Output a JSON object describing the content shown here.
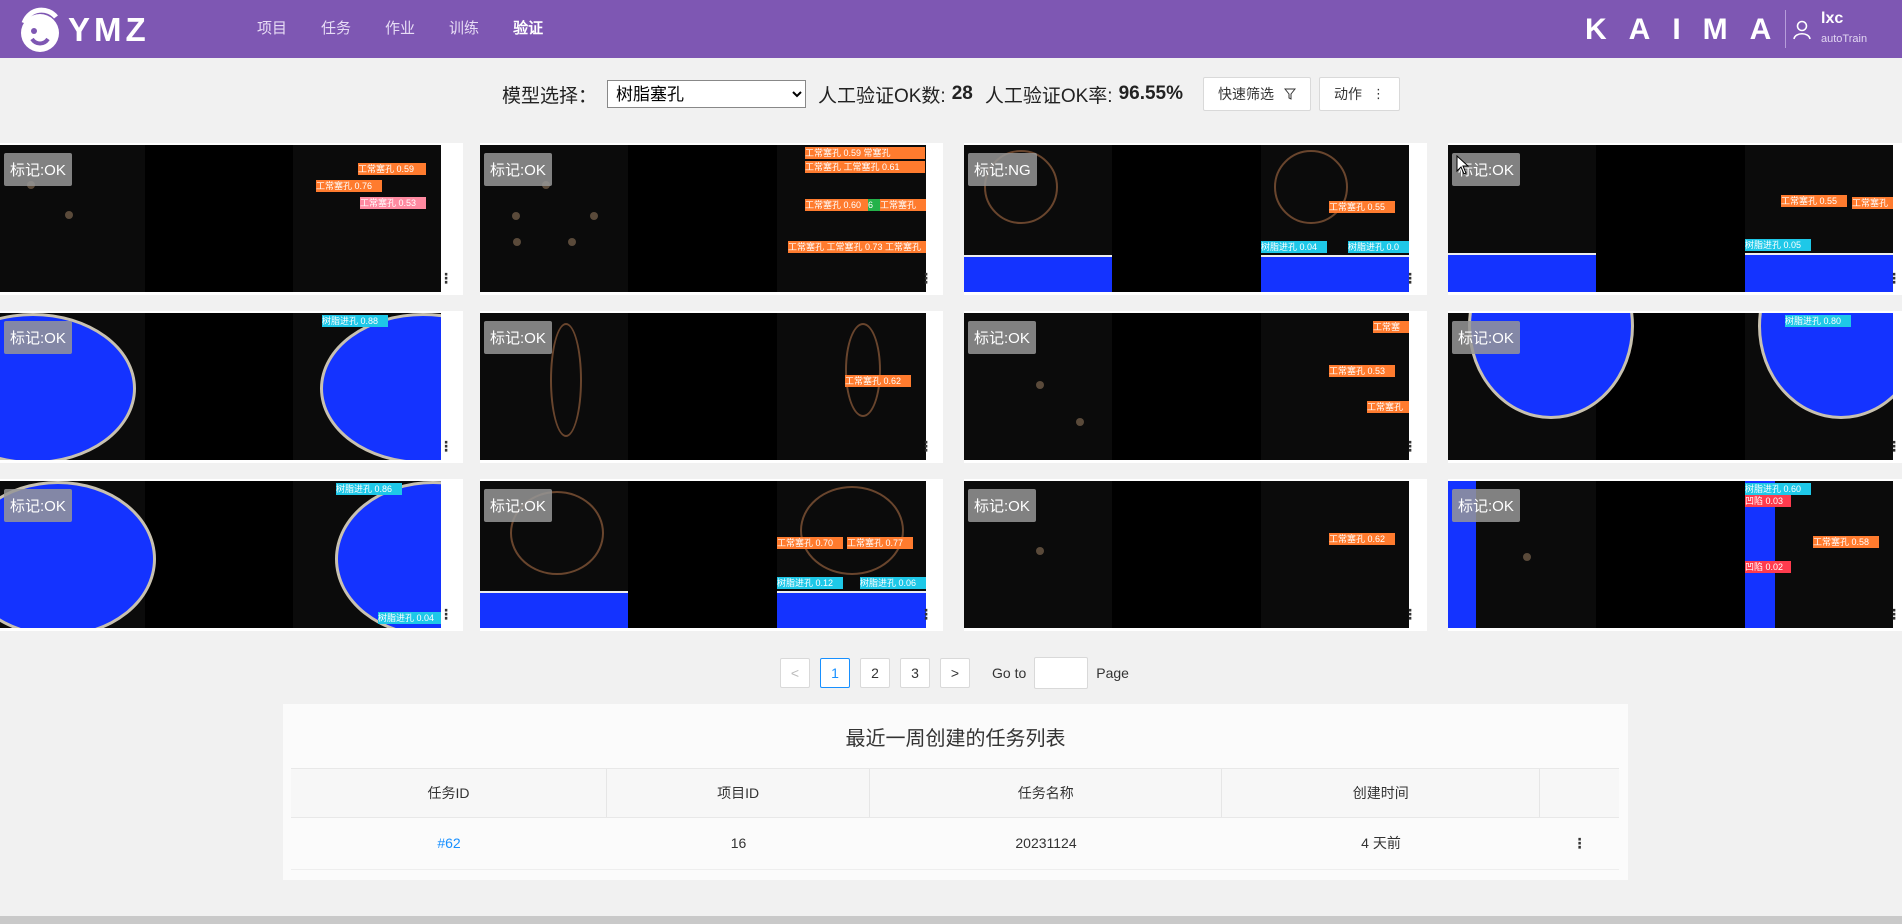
{
  "app": {
    "logo_text": "YMZ",
    "brand": "KAIMA",
    "user_name": "lxc",
    "user_role": "autoTrain"
  },
  "nav": [
    {
      "label": "项目",
      "active": false
    },
    {
      "label": "任务",
      "active": false
    },
    {
      "label": "作业",
      "active": false
    },
    {
      "label": "训练",
      "active": false
    },
    {
      "label": "验证",
      "active": true
    }
  ],
  "toolbar": {
    "model_label": "模型选择：",
    "model_value": "树脂塞孔",
    "ok_count_label": "人工验证OK数:",
    "ok_count": "28",
    "ok_rate_label": "人工验证OK率:",
    "ok_rate": "96.55%",
    "filter_button": "快速筛选",
    "action_button": "动作"
  },
  "cards": [
    {
      "tag": "标记:OK"
    },
    {
      "tag": "标记:OK"
    },
    {
      "tag": "标记:NG"
    },
    {
      "tag": "标记:OK"
    },
    {
      "tag": "标记:OK"
    },
    {
      "tag": "标记:OK"
    },
    {
      "tag": "标记:OK"
    },
    {
      "tag": "标记:OK"
    },
    {
      "tag": "标记:OK"
    },
    {
      "tag": "标记:OK"
    },
    {
      "tag": "标记:OK"
    },
    {
      "tag": "标记:OK"
    }
  ],
  "pagination": {
    "pages": [
      "1",
      "2",
      "3"
    ],
    "current": "1",
    "prev": "<",
    "next": ">",
    "goto_label": "Go to",
    "page_label": "Page"
  },
  "recent_tasks": {
    "title": "最近一周创建的任务列表",
    "columns": [
      "任务ID",
      "项目ID",
      "任务名称",
      "创建时间",
      ""
    ],
    "rows": [
      {
        "task_id": "#62",
        "project_id": "16",
        "task_name": "20231124",
        "created": "4 天前"
      }
    ]
  }
}
